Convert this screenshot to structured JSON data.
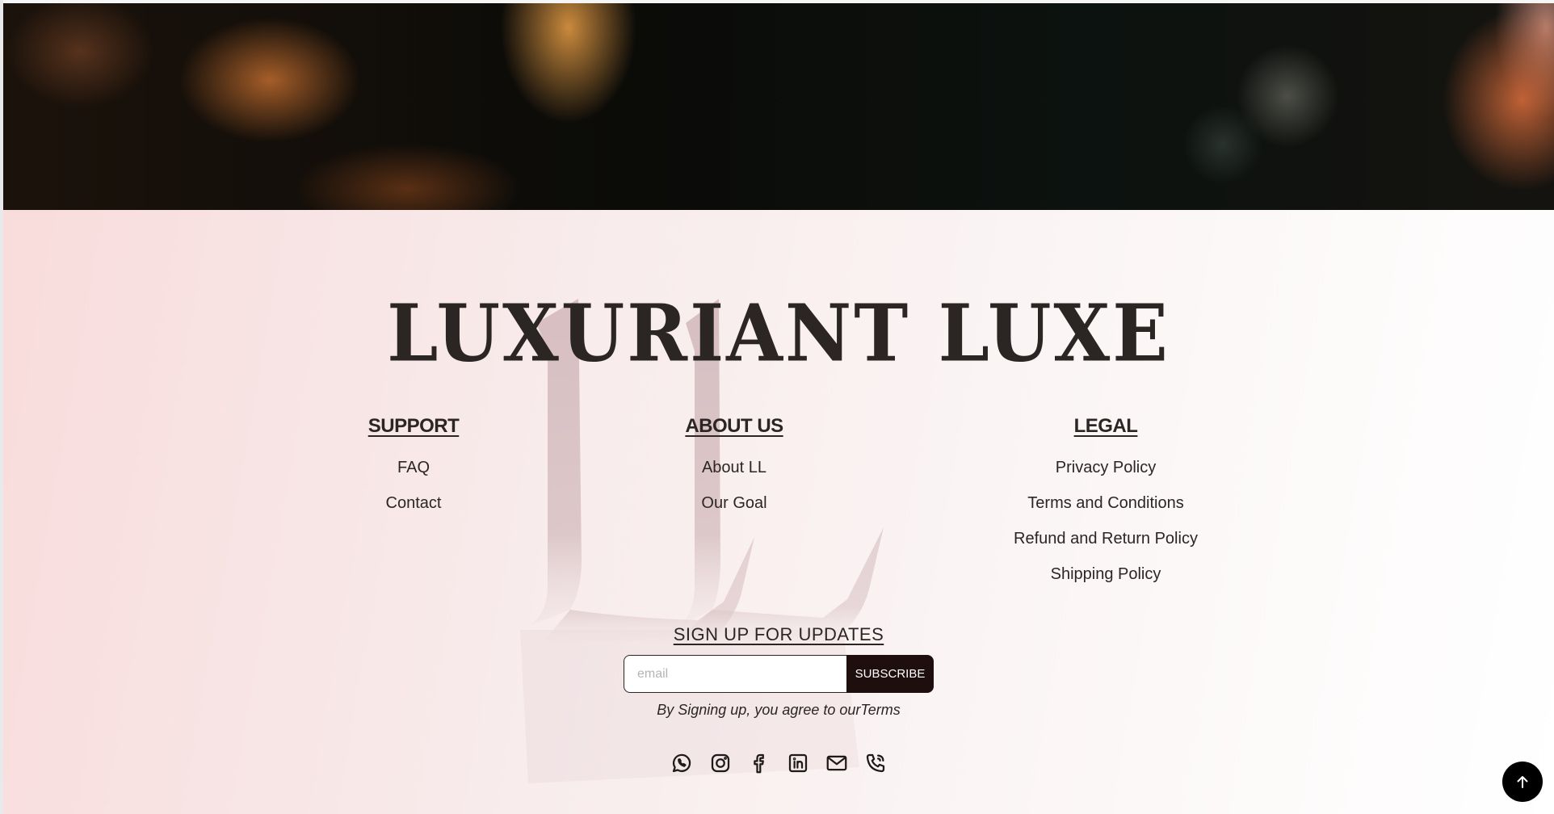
{
  "brand": {
    "name": "LUXURIANT LUXE",
    "monogram_letters": "LL"
  },
  "columns": {
    "support": {
      "heading": "SUPPORT",
      "links": [
        "FAQ",
        "Contact"
      ]
    },
    "about": {
      "heading": "ABOUT US",
      "links": [
        "About LL",
        "Our Goal"
      ]
    },
    "legal": {
      "heading": "LEGAL",
      "links": [
        "Privacy Policy",
        "Terms and Conditions",
        "Refund and Return Policy",
        "Shipping Policy"
      ]
    }
  },
  "signup": {
    "heading": "SIGN UP FOR UPDATES",
    "email_placeholder": "email",
    "email_value": "",
    "button_label": "SUBSCRIBE",
    "terms_text": "By Signing up, you agree to ourTerms"
  },
  "social_icons": [
    "whatsapp-icon",
    "instagram-icon",
    "facebook-icon",
    "linkedin-icon",
    "mail-icon",
    "phone-icon"
  ],
  "back_to_top": {
    "icon": "arrow-up-icon"
  },
  "colors": {
    "text": "#2b2624",
    "button_bg": "#1f0e0e",
    "footer_gradient_start": "#f9dcdc",
    "footer_gradient_end": "#ffffff",
    "monogram": "#d9c3c5"
  }
}
